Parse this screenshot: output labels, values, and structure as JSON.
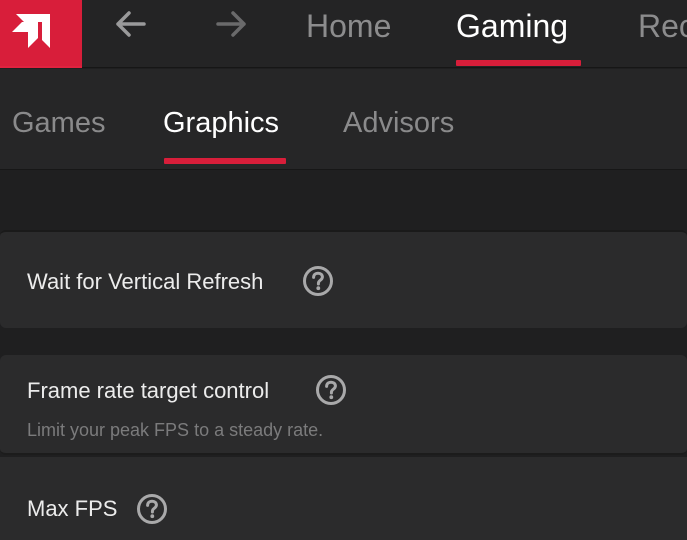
{
  "nav": {
    "tabs": [
      {
        "label": "Home"
      },
      {
        "label": "Gaming",
        "active": true
      },
      {
        "label": "Rec"
      }
    ]
  },
  "subnav": {
    "tabs": [
      {
        "label": "Games"
      },
      {
        "label": "Graphics",
        "active": true
      },
      {
        "label": "Advisors"
      }
    ]
  },
  "settings": {
    "wait_vertical_refresh": {
      "label": "Wait for Vertical Refresh"
    },
    "frame_rate_target": {
      "label": "Frame rate target control",
      "description": "Limit your peak FPS to a steady rate."
    },
    "max_fps": {
      "label": "Max FPS"
    }
  },
  "icons": {
    "logo": "amd-logo-icon",
    "back": "arrow-left-icon",
    "forward": "arrow-right-icon",
    "help": "question-circle-icon"
  },
  "colors": {
    "accent": "#d81e3a",
    "background": "#1f1f20",
    "card": "#2b2b2c",
    "text_primary": "#ffffff",
    "text_muted": "#8a8a8b"
  }
}
